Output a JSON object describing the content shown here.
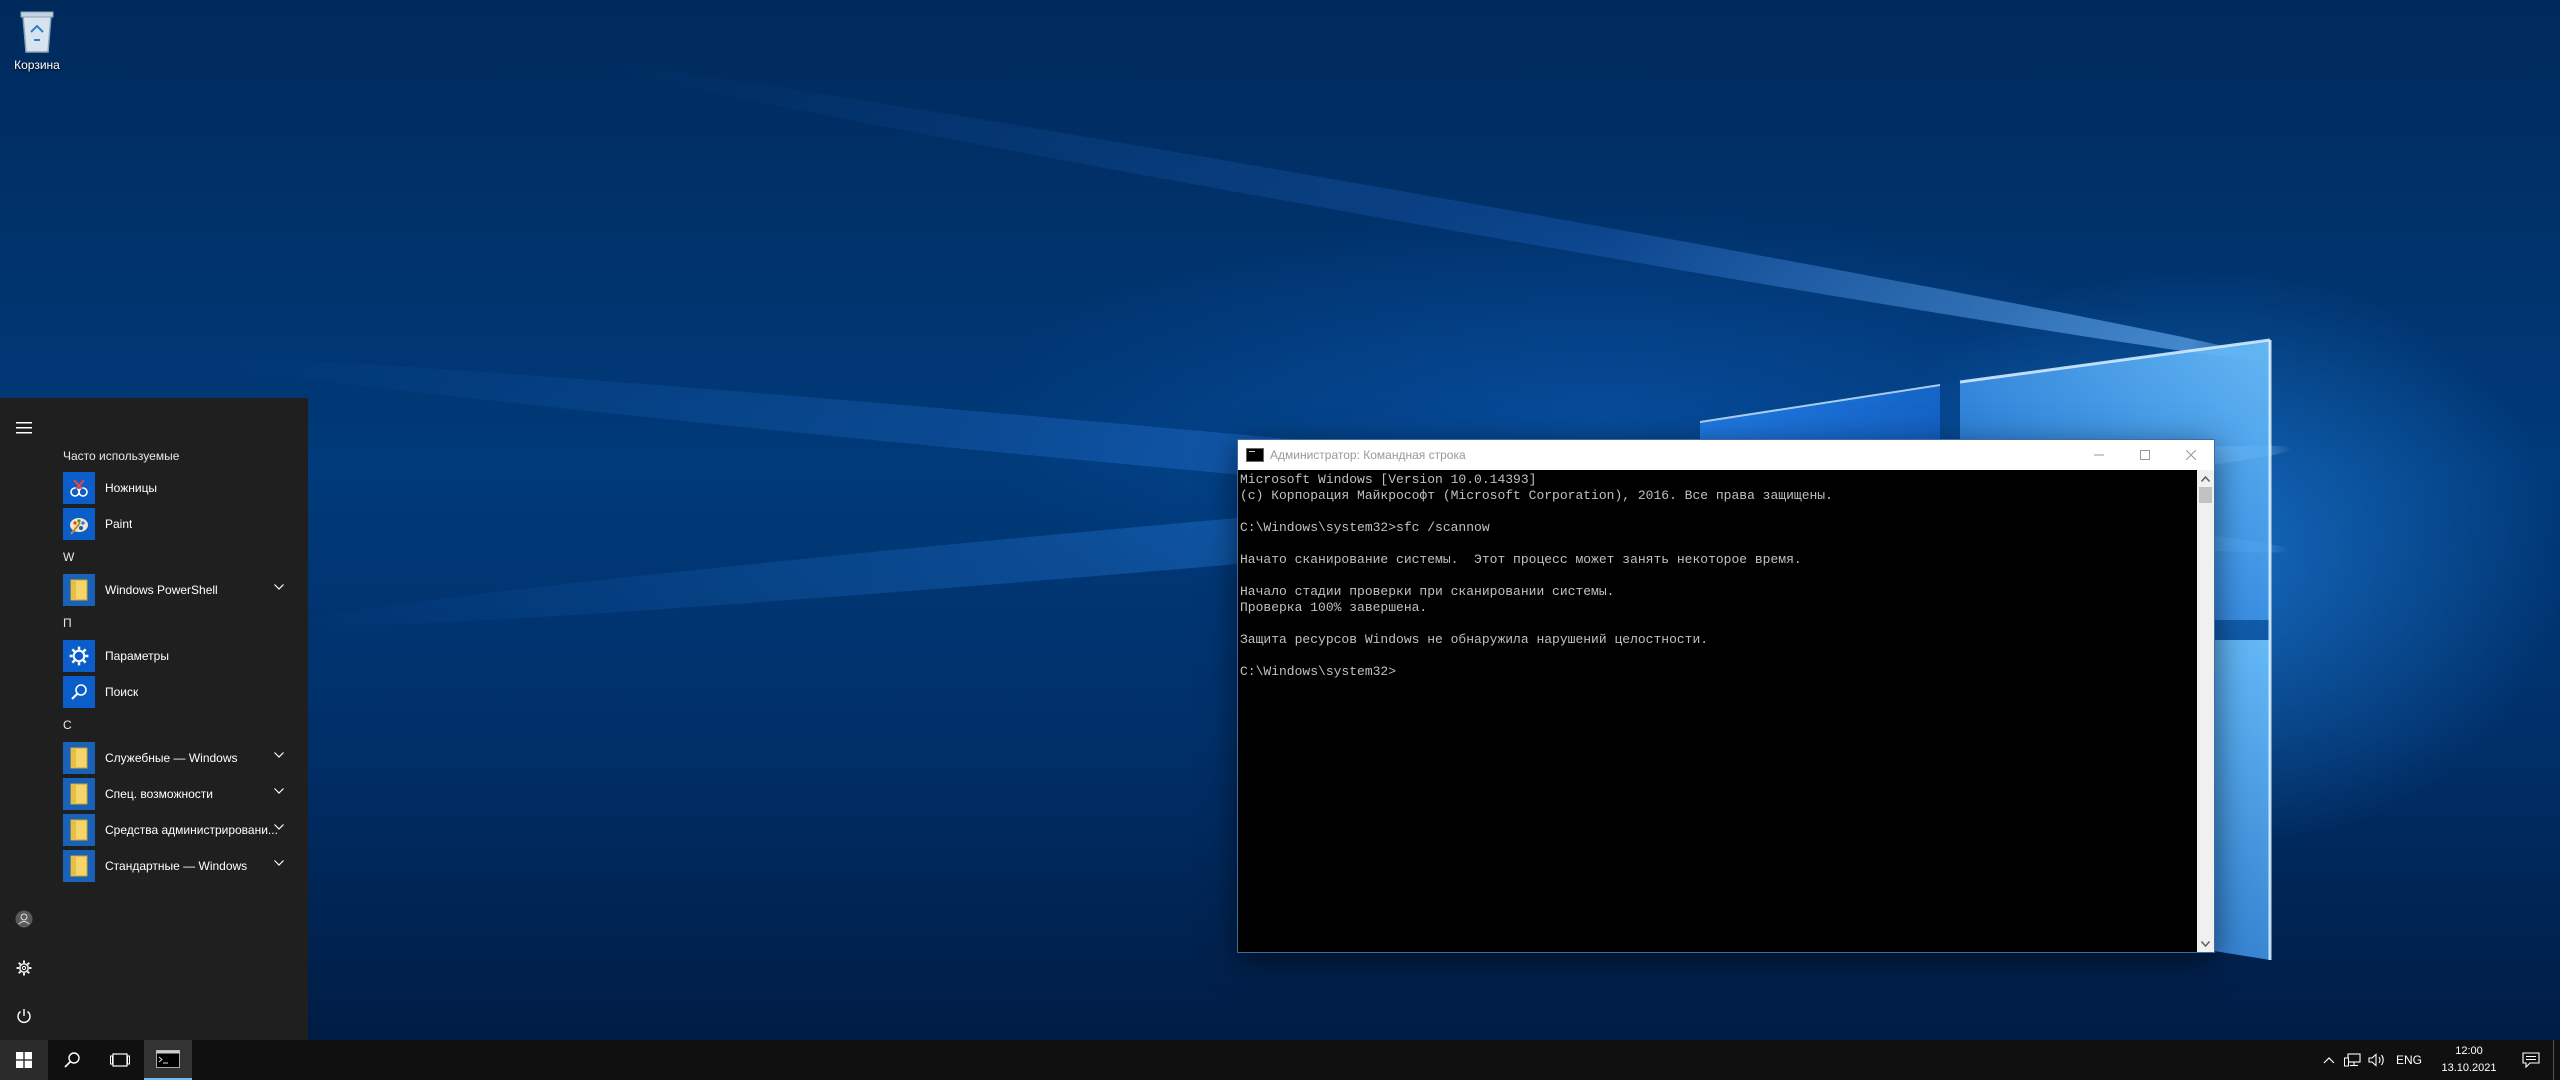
{
  "desktop": {
    "icons": [
      {
        "label": "Корзина",
        "icon": "recycle-bin-icon"
      }
    ]
  },
  "start_menu": {
    "rail": {
      "menu": "hamburger-icon",
      "user": "user-icon",
      "settings": "gear-icon",
      "power": "power-icon"
    },
    "groups": [
      {
        "heading": "Часто используемые",
        "apps": [
          {
            "label": "Ножницы",
            "icon": "snipping-tool-icon"
          },
          {
            "label": "Paint",
            "icon": "paint-icon"
          }
        ]
      },
      {
        "heading": "W",
        "apps": [
          {
            "label": "Windows PowerShell",
            "icon": "folder-icon",
            "expandable": true
          }
        ]
      },
      {
        "heading": "П",
        "apps": [
          {
            "label": "Параметры",
            "icon": "gear-icon"
          },
          {
            "label": "Поиск",
            "icon": "search-icon"
          }
        ]
      },
      {
        "heading": "С",
        "apps": [
          {
            "label": "Служебные — Windows",
            "icon": "folder-icon",
            "expandable": true
          },
          {
            "label": "Спец. возможности",
            "icon": "folder-icon",
            "expandable": true
          },
          {
            "label": "Средства администрировани...",
            "icon": "folder-icon",
            "expandable": true
          },
          {
            "label": "Стандартные — Windows",
            "icon": "folder-icon",
            "expandable": true
          }
        ]
      }
    ]
  },
  "cmd_window": {
    "title": "Администратор: Командная строка",
    "lines": [
      "Microsoft Windows [Version 10.0.14393]",
      "(c) Корпорация Майкрософт (Microsoft Corporation), 2016. Все права защищены.",
      "",
      "C:\\Windows\\system32>sfc /scannow",
      "",
      "Начато сканирование системы.  Этот процесс может занять некоторое время.",
      "",
      "Начало стадии проверки при сканировании системы.",
      "Проверка 100% завершена.",
      "",
      "Защита ресурсов Windows не обнаружила нарушений целостности.",
      "",
      "C:\\Windows\\system32>"
    ]
  },
  "taskbar": {
    "buttons": [
      "windows-start-icon",
      "search-icon",
      "task-view-icon",
      "cmd-icon"
    ],
    "tray": {
      "language": "ENG",
      "time": "12:00",
      "date": "13.10.2021"
    }
  },
  "colors": {
    "start_bg": "#1f1f1f",
    "taskbar_bg": "#101010",
    "accent": "#0b5ec9",
    "console_text": "#c0c0c0"
  }
}
